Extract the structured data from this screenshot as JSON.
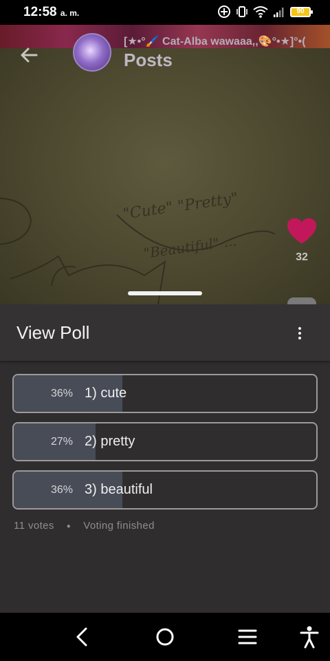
{
  "status_bar": {
    "time": "12:58",
    "ampm": "a. m.",
    "battery": "90"
  },
  "header": {
    "community_name": "[★•°🖌️ Cat-Alba wawaaa,,🎨°•★]°•(",
    "title": "Posts"
  },
  "post": {
    "like_count": "32"
  },
  "poll": {
    "title": "View Poll",
    "options": [
      {
        "percent": "36%",
        "label": "1) cute",
        "fraction": 0.36
      },
      {
        "percent": "27%",
        "label": "2) pretty",
        "fraction": 0.27
      },
      {
        "percent": "36%",
        "label": "3) beautiful",
        "fraction": 0.36
      }
    ],
    "votes": "11 votes",
    "status": "Voting finished"
  },
  "colors": {
    "poll_fill": "#474c57",
    "like_heart": "#c2185b"
  }
}
